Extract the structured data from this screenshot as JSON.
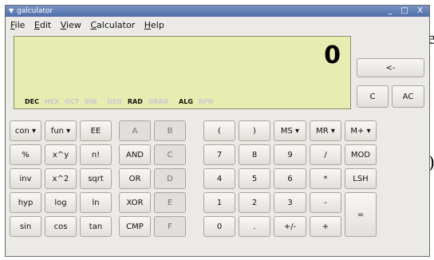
{
  "window": {
    "title": "galculator",
    "controls": "_ □ X"
  },
  "menu": [
    "File",
    "Edit",
    "View",
    "Calculator",
    "Help"
  ],
  "display": {
    "value": "0"
  },
  "flags": [
    {
      "label": "DEC",
      "active": true
    },
    {
      "label": "HEX",
      "active": false
    },
    {
      "label": "OCT",
      "active": false
    },
    {
      "label": "BIN",
      "active": false
    },
    {
      "label": "DEG",
      "active": false
    },
    {
      "label": "RAD",
      "active": true
    },
    {
      "label": "GRAD",
      "active": false
    },
    {
      "label": "ALG",
      "active": true
    },
    {
      "label": "RPN",
      "active": false
    }
  ],
  "side_buttons": {
    "backspace": "<-",
    "clear": "C",
    "all_clear": "AC"
  },
  "rows": [
    [
      "con ▾",
      "fun ▾",
      "EE",
      "A",
      "B",
      "(",
      ")",
      "MS ▾",
      "MR ▾",
      "M+ ▾"
    ],
    [
      "%",
      "x^y",
      "n!",
      "AND",
      "C",
      "7",
      "8",
      "9",
      "/",
      "MOD"
    ],
    [
      "inv",
      "x^2",
      "sqrt",
      "OR",
      "D",
      "4",
      "5",
      "6",
      "*",
      "LSH"
    ],
    [
      "hyp",
      "log",
      "ln",
      "XOR",
      "E",
      "1",
      "2",
      "3",
      "-",
      "="
    ],
    [
      "sin",
      "cos",
      "tan",
      "CMP",
      "F",
      "0",
      ".",
      "+/-",
      "+"
    ]
  ],
  "backdrop_chars": [
    "e",
    ")"
  ]
}
